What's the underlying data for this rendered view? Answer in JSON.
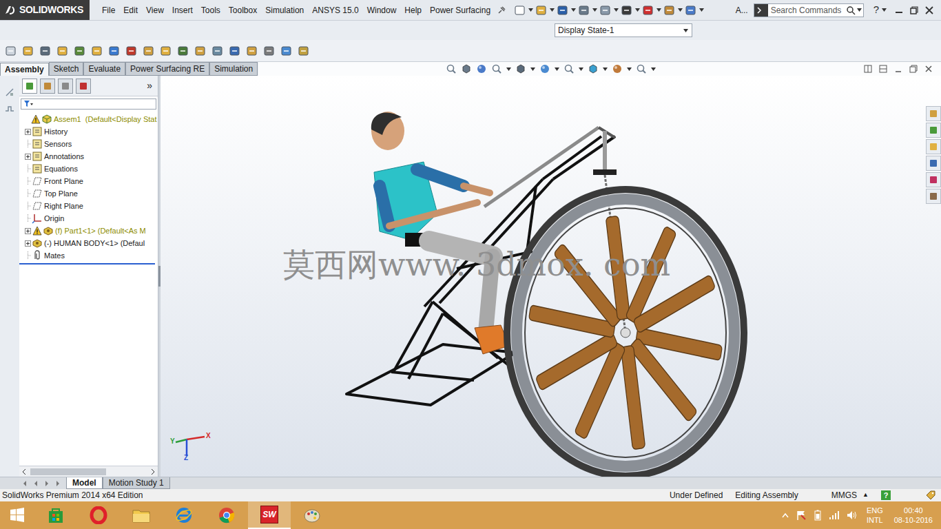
{
  "app": {
    "logo": "SOLIDWORKS",
    "help": "?",
    "overflow": "A..."
  },
  "menu": [
    "File",
    "Edit",
    "View",
    "Insert",
    "Tools",
    "Toolbox",
    "Simulation",
    "ANSYS 15.0",
    "Window",
    "Help",
    "Power Surfacing"
  ],
  "search": {
    "placeholder": "Search Commands"
  },
  "display_state": {
    "value": "Display State-1"
  },
  "command_tabs": [
    {
      "label": "Assembly",
      "selected": true
    },
    {
      "label": "Sketch",
      "selected": false
    },
    {
      "label": "Evaluate",
      "selected": false
    },
    {
      "label": "Power Surfacing RE",
      "selected": false
    },
    {
      "label": "Simulation",
      "selected": false
    }
  ],
  "panel": {
    "more": "»"
  },
  "tree": [
    {
      "label": "Assem1  (Default<Display Stat",
      "kind": "root",
      "expander": false,
      "warning": true
    },
    {
      "label": "History",
      "kind": "folder",
      "expander": true,
      "warning": false
    },
    {
      "label": "Sensors",
      "kind": "folder",
      "expander": false,
      "warning": false
    },
    {
      "label": "Annotations",
      "kind": "folder",
      "expander": true,
      "warning": false
    },
    {
      "label": "Equations",
      "kind": "folder",
      "expander": false,
      "warning": false
    },
    {
      "label": "Front Plane",
      "kind": "plane",
      "expander": false,
      "warning": false
    },
    {
      "label": "Top Plane",
      "kind": "plane",
      "expander": false,
      "warning": false
    },
    {
      "label": "Right Plane",
      "kind": "plane",
      "expander": false,
      "warning": false
    },
    {
      "label": "Origin",
      "kind": "origin",
      "expander": false,
      "warning": false
    },
    {
      "label": "(f) Part1<1> (Default<As M",
      "kind": "component",
      "expander": true,
      "warning": true
    },
    {
      "label": "(-) HUMAN BODY<1> (Defaul",
      "kind": "component",
      "expander": true,
      "warning": false
    },
    {
      "label": "Mates",
      "kind": "mates",
      "expander": false,
      "warning": false
    }
  ],
  "watermark": "莫西网www. 3dmox. com",
  "triad": [
    {
      "label": "Y",
      "color": "#2e9e3a"
    },
    {
      "label": "X",
      "color": "#d42a2a"
    },
    {
      "label": "Z",
      "color": "#2a4fd4"
    }
  ],
  "bottom_tabs": [
    {
      "label": "Model",
      "selected": true
    },
    {
      "label": "Motion Study 1",
      "selected": false
    }
  ],
  "status_bar": {
    "edition": "SolidWorks Premium 2014 x64 Edition",
    "definition": "Under Defined",
    "mode": "Editing Assembly",
    "units": "MMGS",
    "units_menu": "▲",
    "help": "?"
  },
  "taskbar": {
    "sw": "SW",
    "language": "ENG",
    "layout": "INTL",
    "time": "00:40",
    "date": "08-10-2016"
  }
}
